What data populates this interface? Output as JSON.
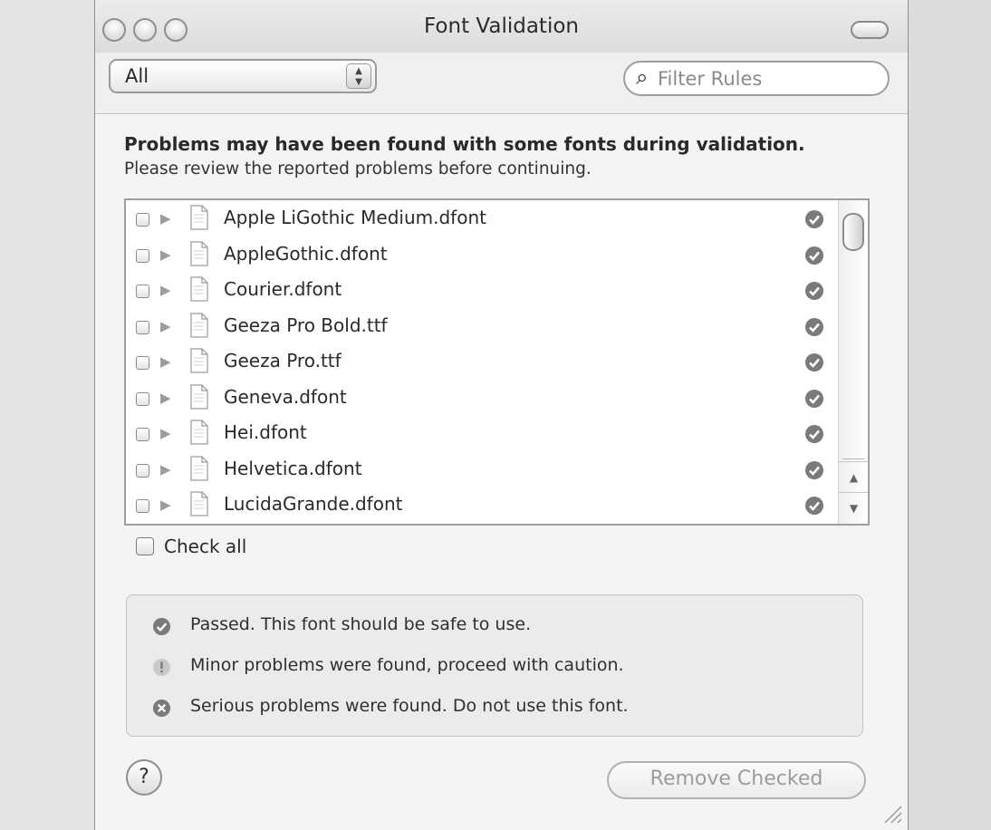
{
  "window": {
    "title": "Font Validation"
  },
  "filter": {
    "selected": "All",
    "search_placeholder": "Filter Rules"
  },
  "message": {
    "heading": "Problems may have been found with some fonts during validation.",
    "subheading": "Please review the reported problems before continuing."
  },
  "fonts": [
    {
      "name": "Apple LiGothic Medium.dfont",
      "status": "passed"
    },
    {
      "name": "AppleGothic.dfont",
      "status": "passed"
    },
    {
      "name": "Courier.dfont",
      "status": "passed"
    },
    {
      "name": "Geeza Pro Bold.ttf",
      "status": "passed"
    },
    {
      "name": "Geeza Pro.ttf",
      "status": "passed"
    },
    {
      "name": "Geneva.dfont",
      "status": "passed"
    },
    {
      "name": "Hei.dfont",
      "status": "passed"
    },
    {
      "name": "Helvetica.dfont",
      "status": "passed"
    },
    {
      "name": "LucidaGrande.dfont",
      "status": "passed"
    }
  ],
  "check_all_label": "Check all",
  "legend": [
    {
      "status": "passed",
      "text": "Passed. This font should be safe to use."
    },
    {
      "status": "minor",
      "text": "Minor problems were found, proceed with caution."
    },
    {
      "status": "serious",
      "text": "Serious problems were found. Do not use this font."
    }
  ],
  "help_label": "?",
  "remove_button_label": "Remove Checked",
  "icons": {
    "search": "magnifier-icon",
    "passed": "check-circle-icon",
    "minor": "exclamation-circle-icon",
    "serious": "x-circle-icon",
    "document": "document-icon",
    "disclosure": "disclosure-triangle-icon"
  }
}
